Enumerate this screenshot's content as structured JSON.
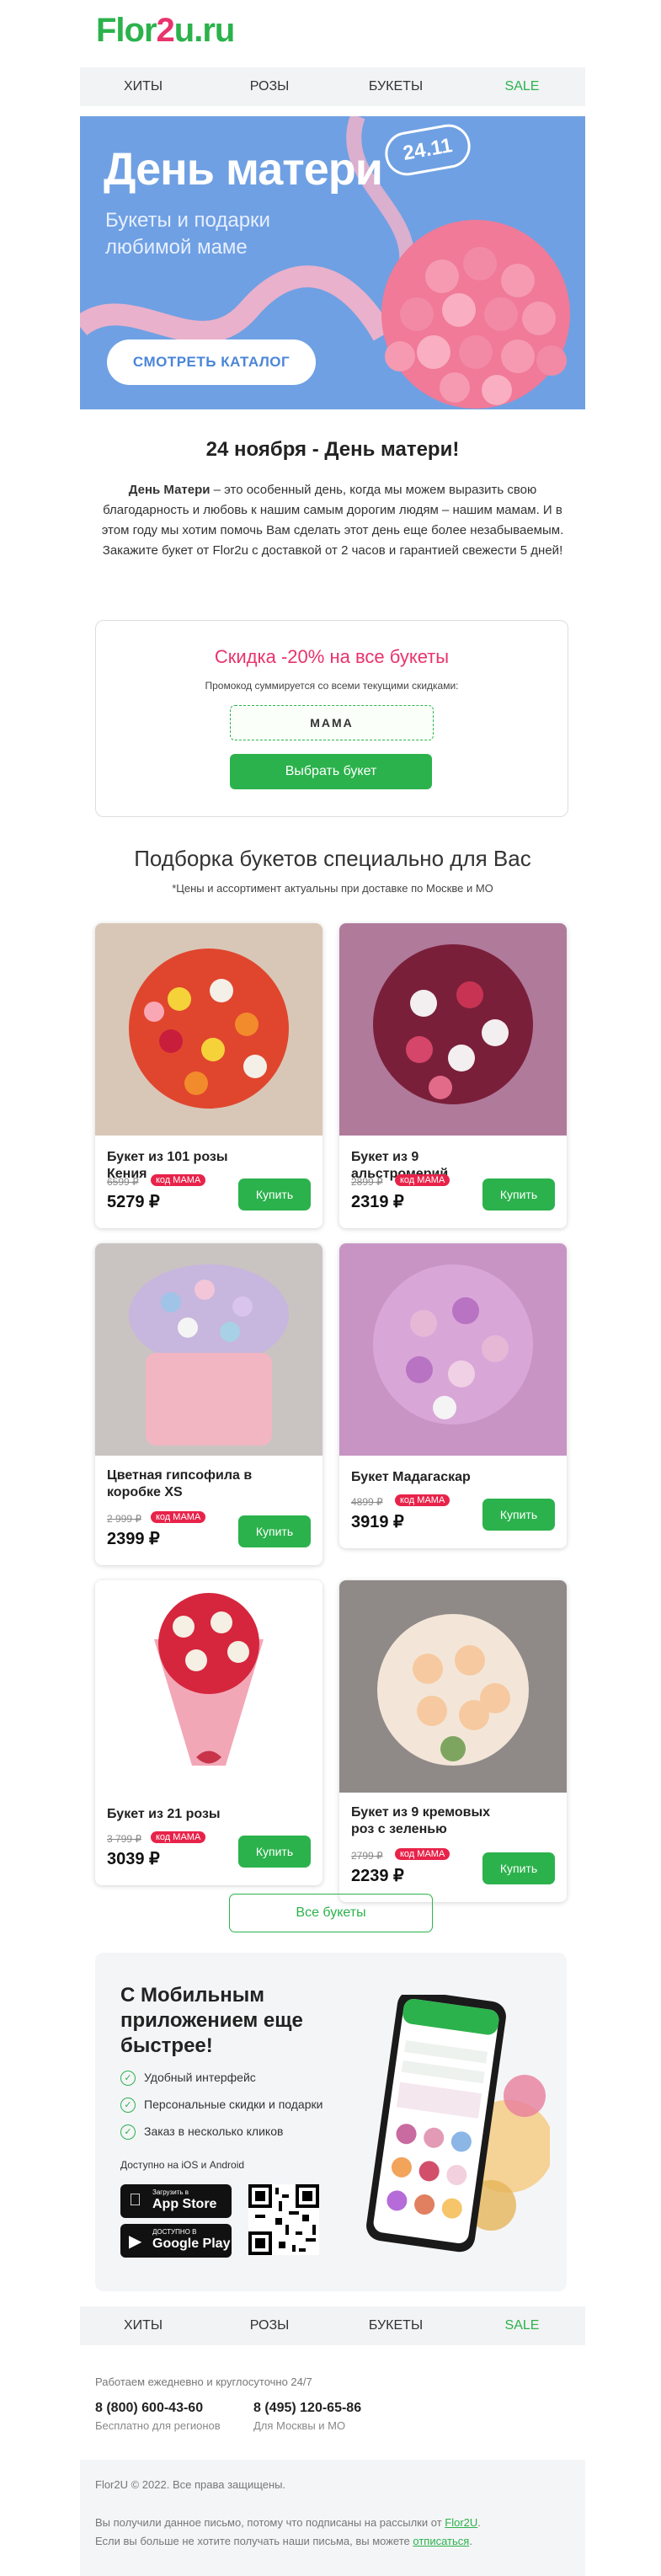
{
  "logo": {
    "green": "Flor",
    "pink": "2",
    "green2": "u.ru"
  },
  "menu": {
    "items": [
      "ХИТЫ",
      "РОЗЫ",
      "БУКЕТЫ",
      "SALE"
    ]
  },
  "hero": {
    "title": "День матери",
    "subtitle": "Букеты и подарки любимой маме",
    "date": "24.11",
    "button": "СМОТРЕТЬ КАТАЛОГ"
  },
  "intro": {
    "heading": "24 ноября - День матери!",
    "bold": "День Матери",
    "text1": " – это особенный день, когда мы можем выразить свою благодарность и любовь к нашим самым дорогим людям – нашим мамам. И в этом году мы хотим помочь Вам сделать этот день еще более незабываемым.",
    "text2": "Закажите букет от Flor2u с доставкой от 2 часов и гарантией свежести 5 дней!"
  },
  "promo": {
    "title": "Скидка -20% на все букеты",
    "note": "Промокод суммируется со всеми текущими скидками:",
    "code": "МАМА",
    "button": "Выбрать букет"
  },
  "selection": {
    "title": "Подборка букетов специально для Вас",
    "note": "*Цены и ассортимент актуальны при доставке по Москве и МО"
  },
  "products": [
    {
      "name": "Букет из 101 розы Кения",
      "old": "6599 ₽",
      "badge": "код МАМА",
      "price": "5279 ₽",
      "buy": "Купить"
    },
    {
      "name": "Букет из 9 альстромерий",
      "old": "2899 ₽",
      "badge": "код МАМА",
      "price": "2319 ₽",
      "buy": "Купить"
    },
    {
      "name": "Цветная гипсофила в коробке XS",
      "old": "2 999 ₽",
      "badge": "код МАМА",
      "price": "2399 ₽",
      "buy": "Купить"
    },
    {
      "name": "Букет Мадагаскар",
      "old": "4899 ₽",
      "badge": "код МАМА",
      "price": "3919 ₽",
      "buy": "Купить"
    },
    {
      "name": "Букет из 21 розы",
      "old": "3 799 ₽",
      "badge": "код МАМА",
      "price": "3039 ₽",
      "buy": "Купить"
    },
    {
      "name": "Букет из 9 кремовых роз с зеленью",
      "old": "2799 ₽",
      "badge": "код МАМА",
      "price": "2239 ₽",
      "buy": "Купить"
    }
  ],
  "all_button": "Все букеты",
  "app": {
    "title": "С Мобильным приложением еще быстрее!",
    "features": [
      "Удобный интерфейс",
      "Персональные скидки и подарки",
      "Заказ в несколько кликов"
    ],
    "available": "Доступно на iOS и Android",
    "appstore_small": "Загрузить в",
    "appstore": "App Store",
    "gplay_small": "ДОСТУПНО В",
    "gplay": "Google Play"
  },
  "contacts": {
    "work": "Работаем ежедневно и круглосуточно 24/7",
    "phone1": "8 (800) 600-43-60",
    "desc1": "Бесплатно для регионов",
    "phone2": "8 (495) 120-65-86",
    "desc2": "Для Москвы и МО"
  },
  "footer": {
    "copyright": "Flor2U © 2022. Все права защищены.",
    "line1": "Вы получили данное письмо, потому что подписаны на рассылки от ",
    "link1": "Flor2U",
    "line2": "Если вы больше не хотите получать наши письма, вы можете ",
    "link2": "отписаться"
  },
  "colors": {
    "brand_green": "#2bb24c",
    "brand_pink": "#e8336d",
    "hero_blue": "#6fa0e3",
    "badge_red": "#e8234a"
  }
}
